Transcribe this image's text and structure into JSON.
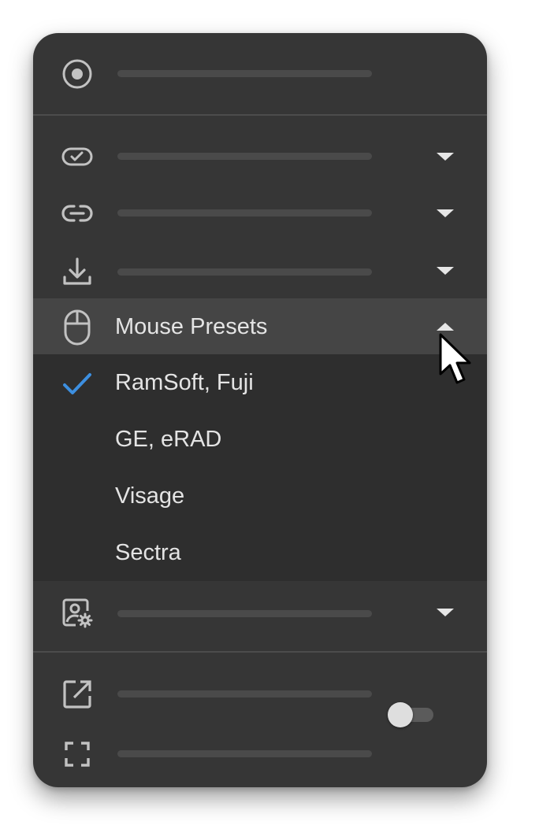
{
  "menu": {
    "mouse_presets": {
      "label": "Mouse Presets",
      "expanded": true,
      "options": [
        {
          "label": "RamSoft, Fuji",
          "selected": true
        },
        {
          "label": "GE, eRAD",
          "selected": false
        },
        {
          "label": "Visage",
          "selected": false
        },
        {
          "label": "Sectra",
          "selected": false
        }
      ]
    },
    "fullscreen_toggle": {
      "on": false
    }
  },
  "icons": {
    "row1": "target-icon",
    "row2": "badge-check-icon",
    "row3": "link-icon",
    "row4": "download-icon",
    "row5": "mouse-icon",
    "row6": "user-settings-icon",
    "row7": "open-in-new-icon",
    "row8": "fullscreen-icon"
  },
  "colors": {
    "panel_bg": "#363636",
    "header_highlight": "#454545",
    "submenu_bg": "#2e2e2e",
    "check_accent": "#3d8fe0",
    "text": "#e4e4e4"
  }
}
